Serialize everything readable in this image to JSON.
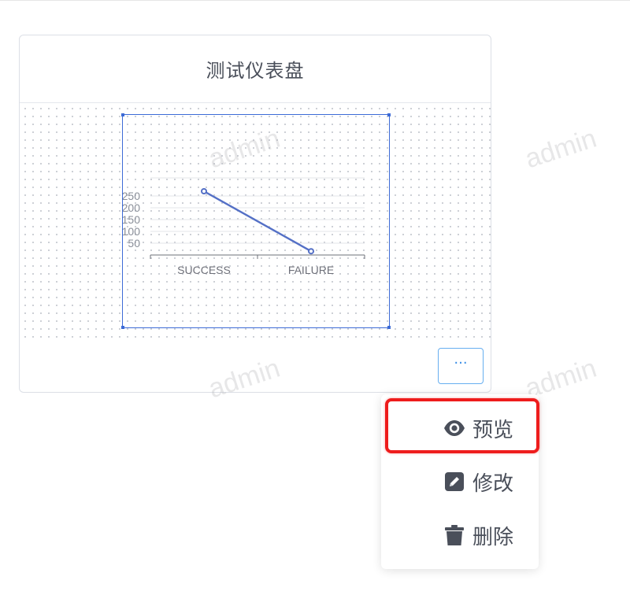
{
  "card": {
    "title": "测试仪表盘",
    "more_label": "···"
  },
  "chart_data": {
    "type": "line",
    "categories": [
      "SUCCESS",
      "FAILURE"
    ],
    "values": [
      270,
      16
    ],
    "y_ticks": [
      "50",
      "100",
      "150",
      "200",
      "250"
    ],
    "ylim": [
      0,
      320
    ],
    "grid": true,
    "color": "#5470c6"
  },
  "watermark": {
    "text": "admin"
  },
  "menu": {
    "items": [
      {
        "label": "预览",
        "icon": "eye-icon"
      },
      {
        "label": "修改",
        "icon": "edit-icon"
      },
      {
        "label": "删除",
        "icon": "trash-icon"
      }
    ]
  },
  "colors": {
    "accent": "#3a8ee6",
    "highlight": "#ee1c1c",
    "chart_frame": "#3d6bd6"
  }
}
